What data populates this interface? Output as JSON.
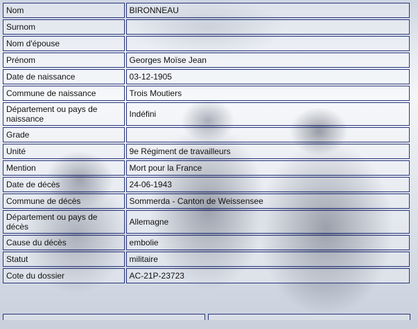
{
  "record": {
    "nom": {
      "label": "Nom",
      "value": "BIRONNEAU"
    },
    "surnom": {
      "label": "Surnom",
      "value": ""
    },
    "nom_epouse": {
      "label": "Nom d'épouse",
      "value": ""
    },
    "prenom": {
      "label": "Prénom",
      "value": "Georges Moïse Jean"
    },
    "date_naissance": {
      "label": "Date de naissance",
      "value": "03-12-1905"
    },
    "commune_naissance": {
      "label": "Commune de naissance",
      "value": "Trois Moutiers"
    },
    "departement_naissance": {
      "label": "Département ou pays de naissance",
      "value": "Indéfini"
    },
    "grade": {
      "label": "Grade",
      "value": ""
    },
    "unite": {
      "label": "Unité",
      "value": "9e Régiment de travailleurs"
    },
    "mention": {
      "label": "Mention",
      "value": "Mort pour la France"
    },
    "date_deces": {
      "label": "Date de décès",
      "value": "24-06-1943"
    },
    "commune_deces": {
      "label": "Commune de décès",
      "value": "Sommerda - Canton de Weissensee"
    },
    "departement_deces": {
      "label": "Département ou pays de décès",
      "value": "Allemagne"
    },
    "cause_deces": {
      "label": "Cause du décès",
      "value": "embolie"
    },
    "statut": {
      "label": "Statut",
      "value": "militaire"
    },
    "cote_dossier": {
      "label": "Cote du dossier",
      "value": "AC-21P-23723"
    }
  }
}
